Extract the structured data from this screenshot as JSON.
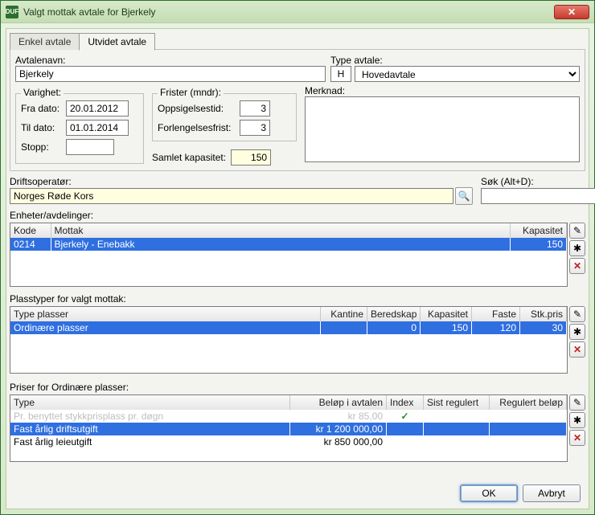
{
  "window": {
    "title": "Valgt mottak avtale for Bjerkely",
    "appIcon": "DUF"
  },
  "tabs": {
    "simple": "Enkel avtale",
    "extended": "Utvidet avtale",
    "active": "extended"
  },
  "labels": {
    "avtalenavn": "Avtalenavn:",
    "typeAvtale": "Type avtale:",
    "varighet": "Varighet:",
    "fraDato": "Fra dato:",
    "tilDato": "Til dato:",
    "stopp": "Stopp:",
    "frister": "Frister (mndr):",
    "oppsigelsestid": "Oppsigelsestid:",
    "forlengelsesfrist": "Forlengelsesfrist:",
    "samletKapasitet": "Samlet kapasitet:",
    "merknad": "Merknad:",
    "driftsoperator": "Driftsoperatør:",
    "sok": "Søk (Alt+D):",
    "enheter": "Enheter/avdelinger:",
    "plasstyper": "Plasstyper for valgt mottak:",
    "priserFor": "Priser for Ordinære plasser:"
  },
  "values": {
    "avtalenavn": "Bjerkely",
    "typeAvtaleCode": "H",
    "typeAvtaleText": "Hovedavtale",
    "fraDato": "20.01.2012",
    "tilDato": "01.01.2014",
    "stopp": "",
    "oppsigelsestid": "3",
    "forlengelsesfrist": "3",
    "samletKapasitet": "150",
    "merknad": "",
    "driftsoperator": "Norges Røde Kors",
    "sok": ""
  },
  "enheterGrid": {
    "cols": {
      "kode": "Kode",
      "mottak": "Mottak",
      "kapasitet": "Kapasitet"
    },
    "rows": [
      {
        "kode": "0214",
        "mottak": "Bjerkely - Enebakk",
        "kapasitet": "150",
        "selected": true
      }
    ]
  },
  "plasserGrid": {
    "cols": {
      "type": "Type plasser",
      "kantine": "Kantine",
      "beredskap": "Beredskap",
      "kapasitet": "Kapasitet",
      "faste": "Faste",
      "stkpris": "Stk.pris"
    },
    "rows": [
      {
        "type": "Ordinære plasser",
        "kantine": "",
        "beredskap": "0",
        "kapasitet": "150",
        "faste": "120",
        "stkpris": "30",
        "selected": true
      }
    ]
  },
  "priserGrid": {
    "cols": {
      "type": "Type",
      "belop": "Beløp i avtalen",
      "index": "Index",
      "sist": "Sist regulert",
      "reg": "Regulert beløp"
    },
    "rows": [
      {
        "type": "Pr. benyttet stykkprisplass pr. døgn",
        "belop": "kr 85,00",
        "index": "✓",
        "dim": true
      },
      {
        "type": "Fast årlig driftsutgift",
        "belop": "kr 1 200 000,00",
        "index": "",
        "selected": true
      },
      {
        "type": "Fast årlig leieutgift",
        "belop": "kr 850 000,00",
        "index": ""
      }
    ]
  },
  "buttons": {
    "ok": "OK",
    "avbryt": "Avbryt"
  },
  "sideIcons": {
    "edit": "✎",
    "new": "✱",
    "del": "✕",
    "search": "🔍",
    "bino": "🔭"
  }
}
